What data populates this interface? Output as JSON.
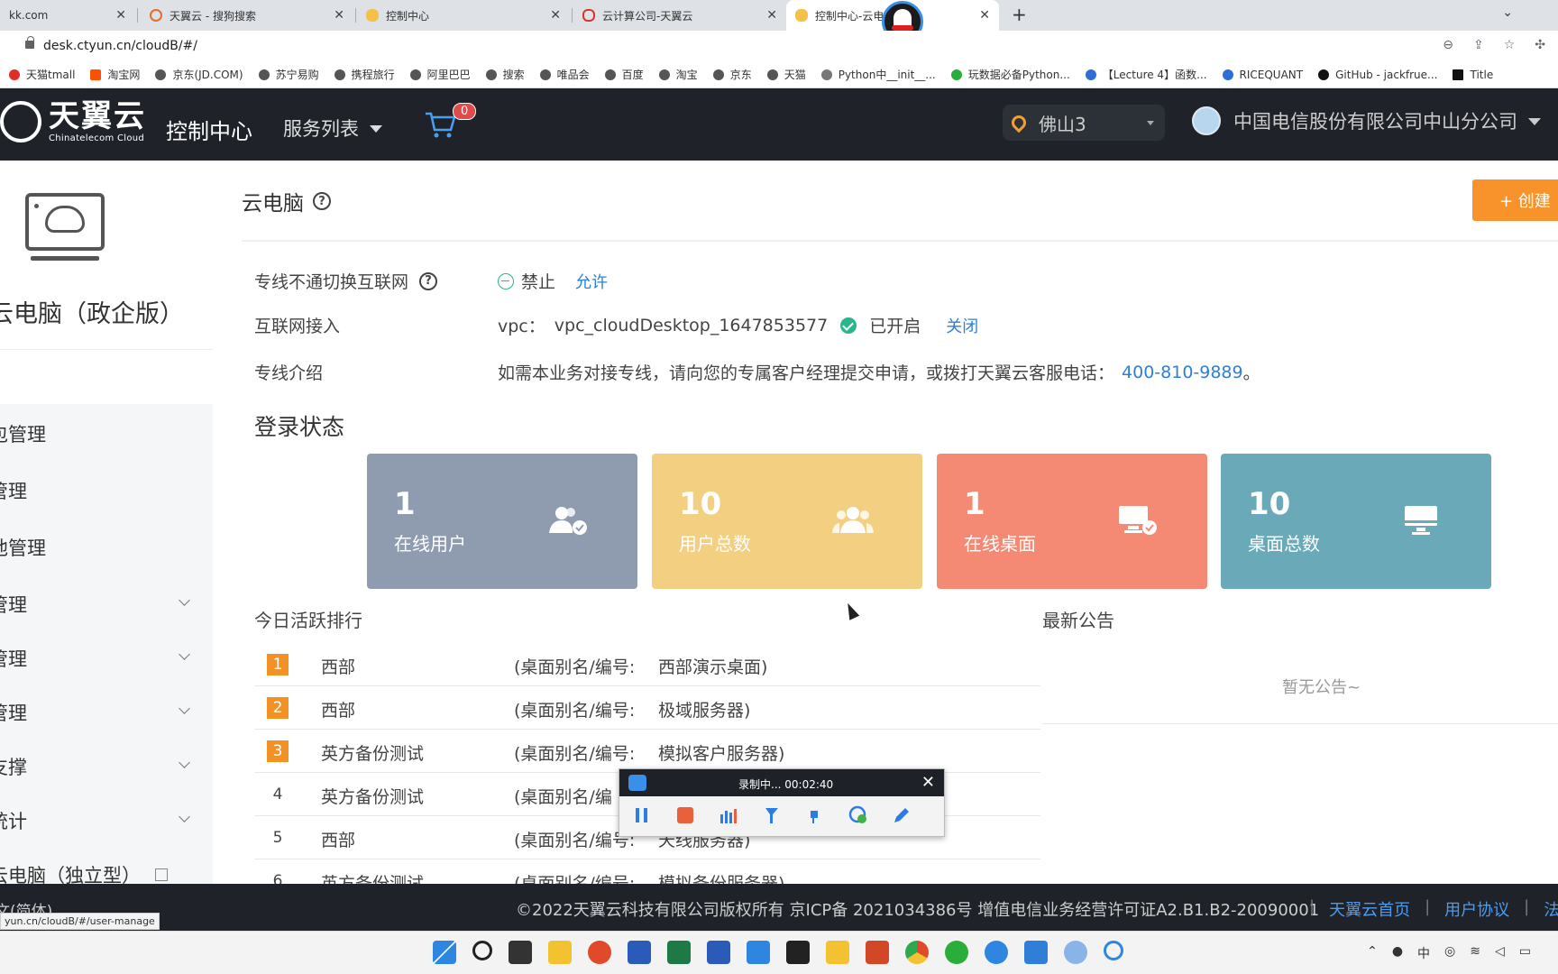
{
  "browser": {
    "tabs": [
      {
        "label": "kk.com",
        "active": false
      },
      {
        "label": "天翼云 - 搜狗搜索",
        "active": false
      },
      {
        "label": "控制中心",
        "active": false
      },
      {
        "label": "云计算公司-天翼云",
        "active": false
      },
      {
        "label": "控制中心-云电",
        "active": true
      }
    ],
    "url": "desk.ctyun.cn/cloudB/#/",
    "bookmarks": [
      "天猫tmall",
      "淘宝网",
      "京东(JD.COM)",
      "苏宁易购",
      "携程旅行",
      "阿里巴巴",
      "搜索",
      "唯品会",
      "百度",
      "淘宝",
      "京东",
      "天猫",
      "Python中__init__...",
      "玩数据必备Python...",
      "【Lecture 4】函数...",
      "RICEQUANT",
      "GitHub - jackfrue...",
      "Title"
    ]
  },
  "header": {
    "brand": "天翼云",
    "brand_sub": "Chinatelecom Cloud",
    "title": "控制中心",
    "service_menu": "服务列表",
    "cart_count": "0",
    "region": "佛山3",
    "account": "中国电信股份有限公司中山分公司"
  },
  "sidebar": {
    "product_title": "云电脑（政企版）",
    "items": [
      {
        "label": "包管理",
        "has_chevron": false
      },
      {
        "label": "管理",
        "has_chevron": false
      },
      {
        "label": "池管理",
        "has_chevron": false
      },
      {
        "label": "管理",
        "has_chevron": true
      },
      {
        "label": "管理",
        "has_chevron": true
      },
      {
        "label": "管理",
        "has_chevron": true
      },
      {
        "label": "支撑",
        "has_chevron": true
      },
      {
        "label": "统计",
        "has_chevron": true
      },
      {
        "label": "云电脑（独立型）",
        "has_chevron": false
      }
    ]
  },
  "main": {
    "page_title": "云电脑",
    "create_button": "+ 创建",
    "private_line_switch": {
      "label": "专线不通切换互联网",
      "state": "禁止",
      "action": "允许"
    },
    "internet_access": {
      "label": "互联网接入",
      "vpc_prefix": "vpc：",
      "vpc_name": "vpc_cloudDesktop_1647853577",
      "status": "已开启",
      "action": "关闭"
    },
    "private_line_intro": {
      "label": "专线介绍",
      "text": "如需本业务对接专线，请向您的专属客户经理提交申请，或拨打天翼云客服电话：",
      "phone": "400-810-9889",
      "suffix": "。"
    },
    "login_status_title": "登录状态",
    "stats": [
      {
        "value": "1",
        "label": "在线用户",
        "color": "#8f9cb0",
        "icon": "users-check-icon"
      },
      {
        "value": "10",
        "label": "用户总数",
        "color": "#f3cf81",
        "icon": "users-icon"
      },
      {
        "value": "1",
        "label": "在线桌面",
        "color": "#f58a74",
        "icon": "desktop-check-icon"
      },
      {
        "value": "10",
        "label": "桌面总数",
        "color": "#6aaab8",
        "icon": "desktop-icon"
      }
    ],
    "ranking_title": "今日活跃排行",
    "ranking": [
      {
        "rank": "1",
        "name": "西部",
        "desc": "(桌面别名/编号:",
        "alias": "西部演示桌面)"
      },
      {
        "rank": "2",
        "name": "西部",
        "desc": "(桌面别名/编号:",
        "alias": "极域服务器)"
      },
      {
        "rank": "3",
        "name": "英方备份测试",
        "desc": "(桌面别名/编号:",
        "alias": "模拟客户服务器)"
      },
      {
        "rank": "4",
        "name": "英方备份测试",
        "desc": "(桌面别名/编",
        "alias": ""
      },
      {
        "rank": "5",
        "name": "西部",
        "desc": "(桌面别名/编号:",
        "alias": "天线服务器)"
      },
      {
        "rank": "6",
        "name": "英方备份测试",
        "desc": "(桌面别名/编号:",
        "alias": "模拟备份服务器)"
      }
    ],
    "notice_title": "最新公告",
    "notice_empty": "暂无公告~"
  },
  "footer": {
    "left_text": "文(简体)",
    "copyright": "©2022天翼云科技有限公司版权所有 京ICP备 2021034386号 增值电信业务经营许可证A2.B1.B2-20090001",
    "links": [
      "天翼云首页",
      "用户协议",
      "法"
    ],
    "status_url": "yun.cn/cloudB/#/user-manage"
  },
  "recorder": {
    "status": "录制中... 00:02:40"
  }
}
